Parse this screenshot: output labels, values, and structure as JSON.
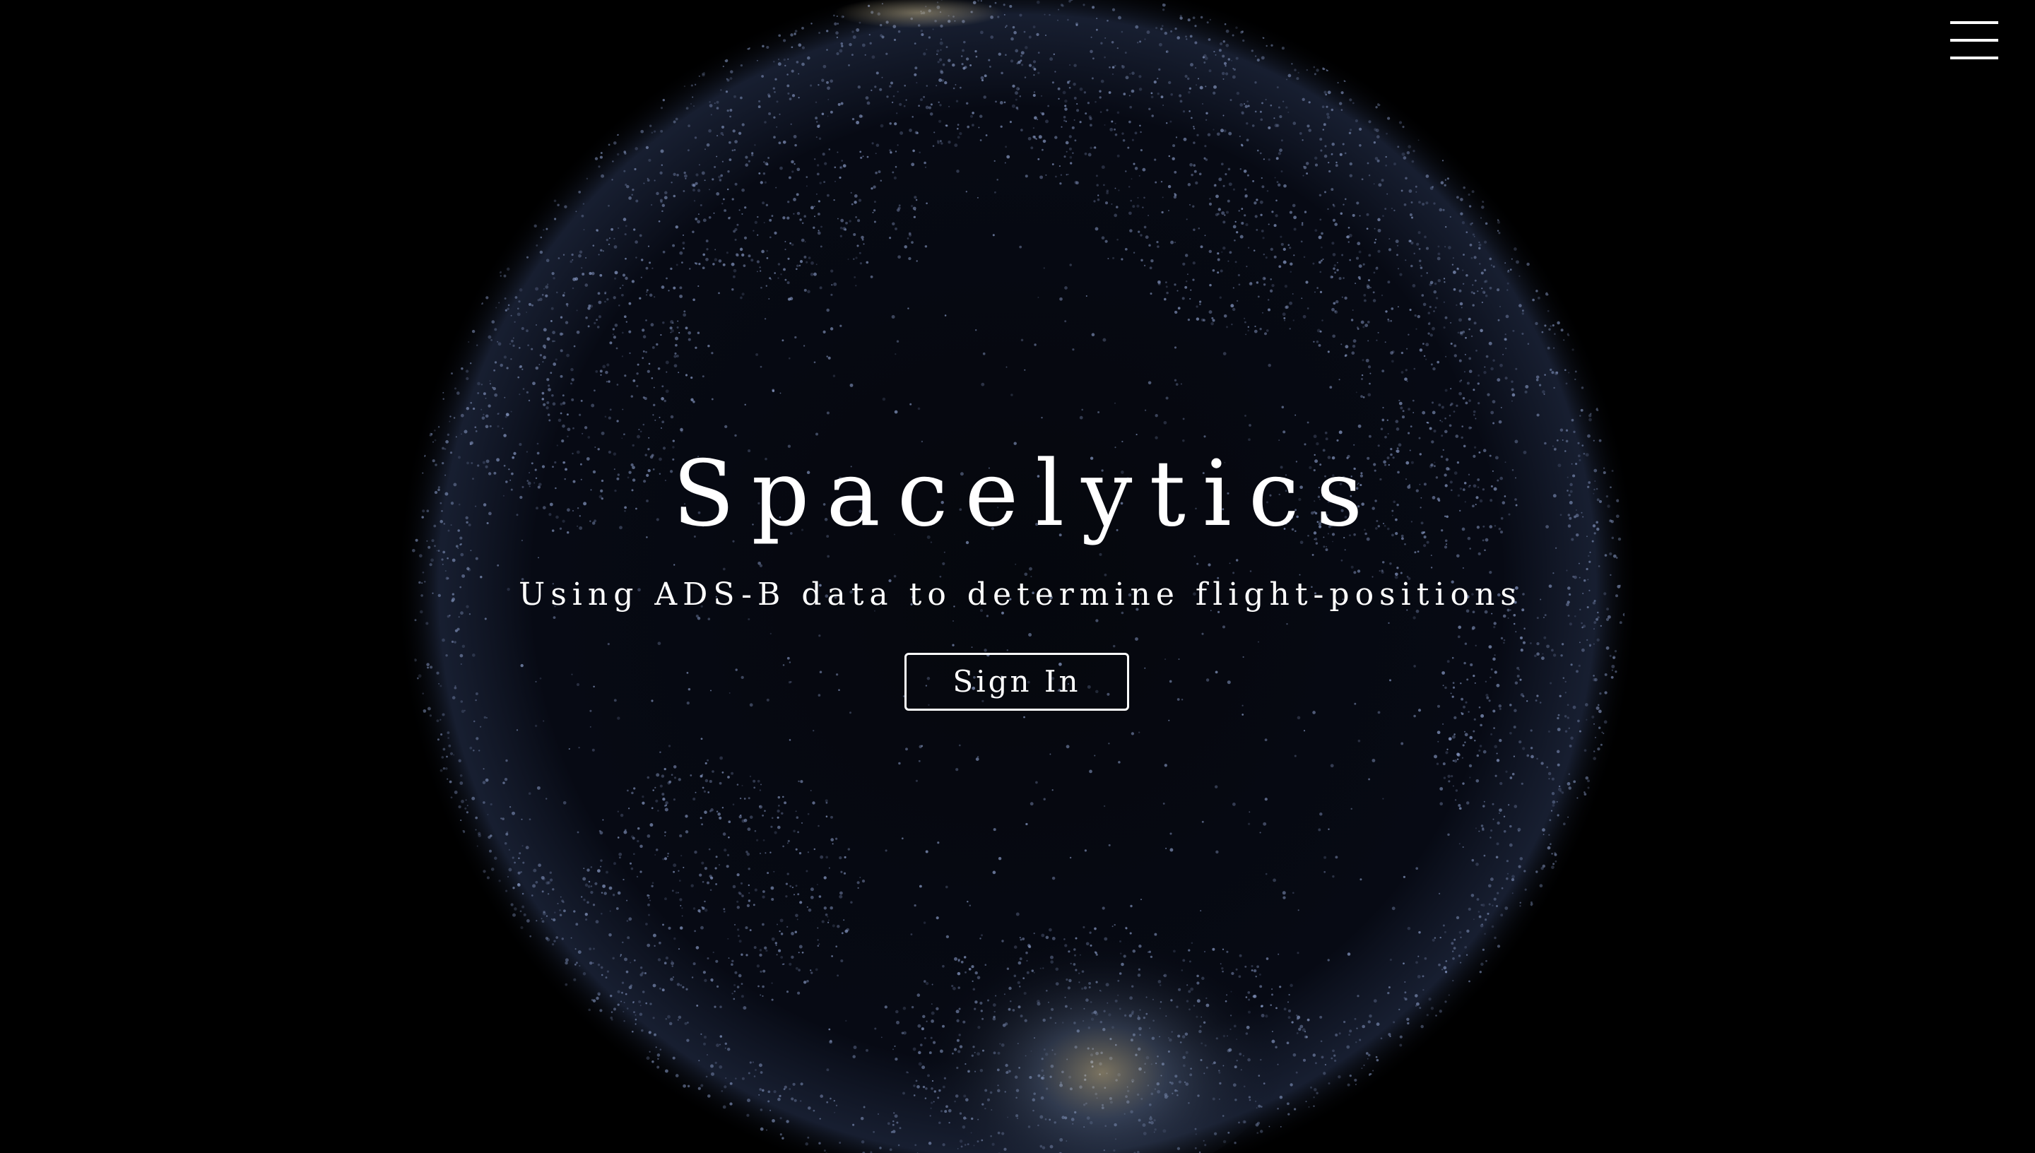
{
  "app": {
    "title": "Spacelytics",
    "subtitle": "Using ADS-B data to determine flight-positions"
  },
  "nav": {
    "menu_icon": "hamburger-menu-icon"
  },
  "actions": {
    "sign_in_label": "Sign In"
  },
  "colors": {
    "background": "#000000",
    "text": "#ffffff",
    "globe_particles": "#8a9cc8",
    "globe_glow": "#1b2238",
    "accent_warm": "#d8c79a"
  }
}
